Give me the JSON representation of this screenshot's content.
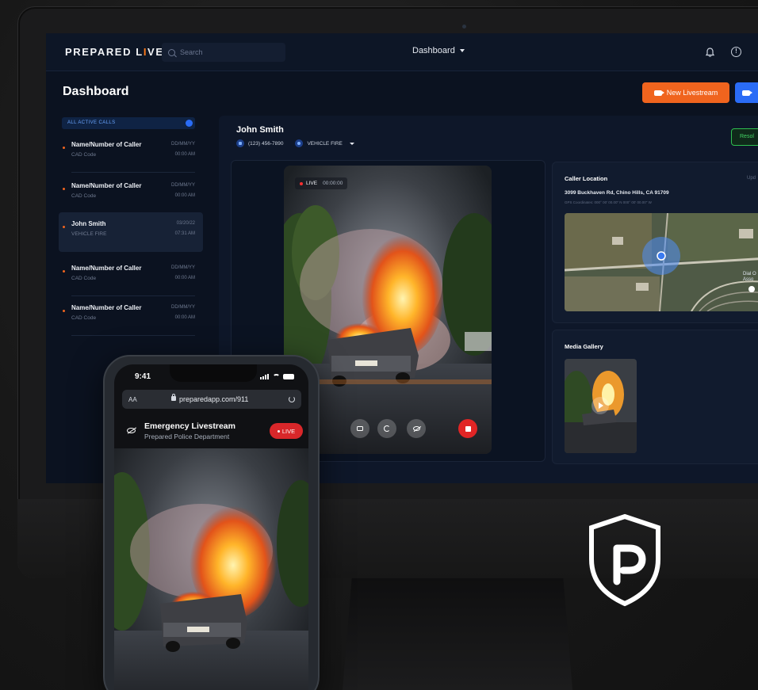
{
  "app": {
    "brand_prefix": "PREPARED L",
    "brand_accent": "I",
    "brand_suffix": "VE",
    "search_placeholder": "Search",
    "nav_label": "Dashboard",
    "accent_color": "#f0641e",
    "primary_color": "#2a6cf6"
  },
  "page": {
    "title": "Dashboard",
    "new_livestream_label": "New Livestream",
    "green_button_label": "Resol"
  },
  "sidebar": {
    "active_calls_label": "ALL ACTIVE CALLS",
    "calls": [
      {
        "name": "Name/Number of Caller",
        "sub": "CAD Code",
        "date": "DD/MM/YY",
        "time": "00:00 AM",
        "selected": false
      },
      {
        "name": "Name/Number of Caller",
        "sub": "CAD Code",
        "date": "DD/MM/YY",
        "time": "00:00 AM",
        "selected": false
      },
      {
        "name": "John Smith",
        "sub": "VEHICLE FIRE",
        "date": "03/20/22",
        "time": "07:31 AM",
        "selected": true
      },
      {
        "name": "Name/Number of Caller",
        "sub": "CAD Code",
        "date": "DD/MM/YY",
        "time": "00:00 AM",
        "selected": false
      },
      {
        "name": "Name/Number of Caller",
        "sub": "CAD Code",
        "date": "DD/MM/YY",
        "time": "00:00 AM",
        "selected": false
      }
    ]
  },
  "caller": {
    "name": "John Smith",
    "phone": "(123) 456-7890",
    "incident_type": "VEHICLE FIRE"
  },
  "video": {
    "live_label": "LIVE",
    "timer": "00:00:00",
    "controls": [
      "camera-icon",
      "switch-camera-icon",
      "hide-icon",
      "stop-icon"
    ]
  },
  "location": {
    "title": "Caller Location",
    "update_label": "Upd",
    "address": "3099 Buckhaven Rd, Chino Hills, CA 91709",
    "gps": "GPS Coordinates: 000° 00' 00.00\" N 000° 00' 00.00\" W",
    "map_label_line1": "Dial O",
    "map_label_line2": "Asso"
  },
  "gallery": {
    "title": "Media Gallery"
  },
  "phone": {
    "time": "9:41",
    "aa_label": "AA",
    "url": "preparedapp.com/911",
    "title": "Emergency Livestream",
    "subtitle": "Prepared Police Department",
    "live_label": "LIVE"
  }
}
